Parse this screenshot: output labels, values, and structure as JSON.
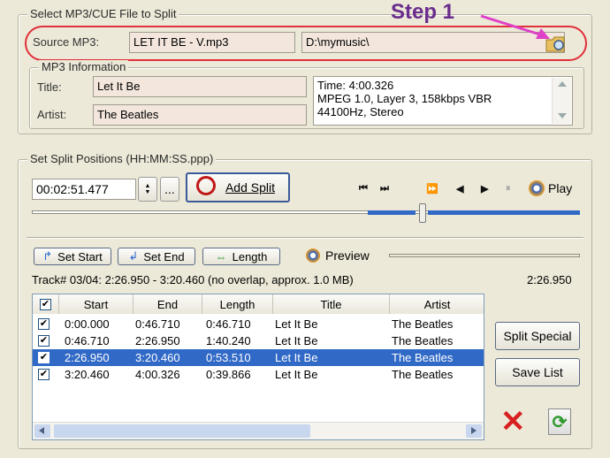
{
  "source_group": {
    "title": "Select MP3/CUE File to Split",
    "label": "Source MP3:",
    "filename": "LET IT BE - V.mp3",
    "folder": "D:\\mymusic\\",
    "step_label": "Step 1"
  },
  "info_group": {
    "title": "MP3 Information",
    "title_label": "Title:",
    "title_value": "Let It Be",
    "artist_label": "Artist:",
    "artist_value": "The Beatles",
    "details": [
      "Time: 4:00.326",
      "MPEG 1.0, Layer 3, 158kbps VBR",
      "44100Hz, Stereo"
    ]
  },
  "split_group": {
    "title": "Set Split Positions (HH:MM:SS.ppp)",
    "time_value": "00:02:51.477",
    "browse_label": "...",
    "add_split_label": "Add Split",
    "play_label": "Play",
    "set_start_label": "Set Start",
    "set_end_label": "Set End",
    "length_label": "Length",
    "preview_label": "Preview",
    "track_info": "Track# 03/04: 2:26.950 - 3:20.460 (no overlap, approx. 1.0 MB)",
    "track_length": "2:26.950",
    "playback_position": 0.72
  },
  "table": {
    "headers": [
      "Start",
      "End",
      "Length",
      "Title",
      "Artist"
    ],
    "rows": [
      {
        "start": "0:00.000",
        "end": "0:46.710",
        "length": "0:46.710",
        "title": "Let It Be",
        "artist": "The Beatles"
      },
      {
        "start": "0:46.710",
        "end": "2:26.950",
        "length": "1:40.240",
        "title": "Let It Be",
        "artist": "The Beatles"
      },
      {
        "start": "2:26.950",
        "end": "3:20.460",
        "length": "0:53.510",
        "title": "Let It Be",
        "artist": "The Beatles"
      },
      {
        "start": "3:20.460",
        "end": "4:00.326",
        "length": "0:39.866",
        "title": "Let It Be",
        "artist": "The Beatles"
      }
    ],
    "selected_row": 2
  },
  "side_buttons": {
    "split_special_label": "Split Special",
    "save_list_label": "Save List"
  },
  "colors": {
    "step_text": "#6B2D8E",
    "step_arrow": "#E040C8",
    "highlight_oval": "#E0303A",
    "selection": "#3169C6",
    "delete_x": "#D82020",
    "refresh": "#2E9A2E"
  }
}
